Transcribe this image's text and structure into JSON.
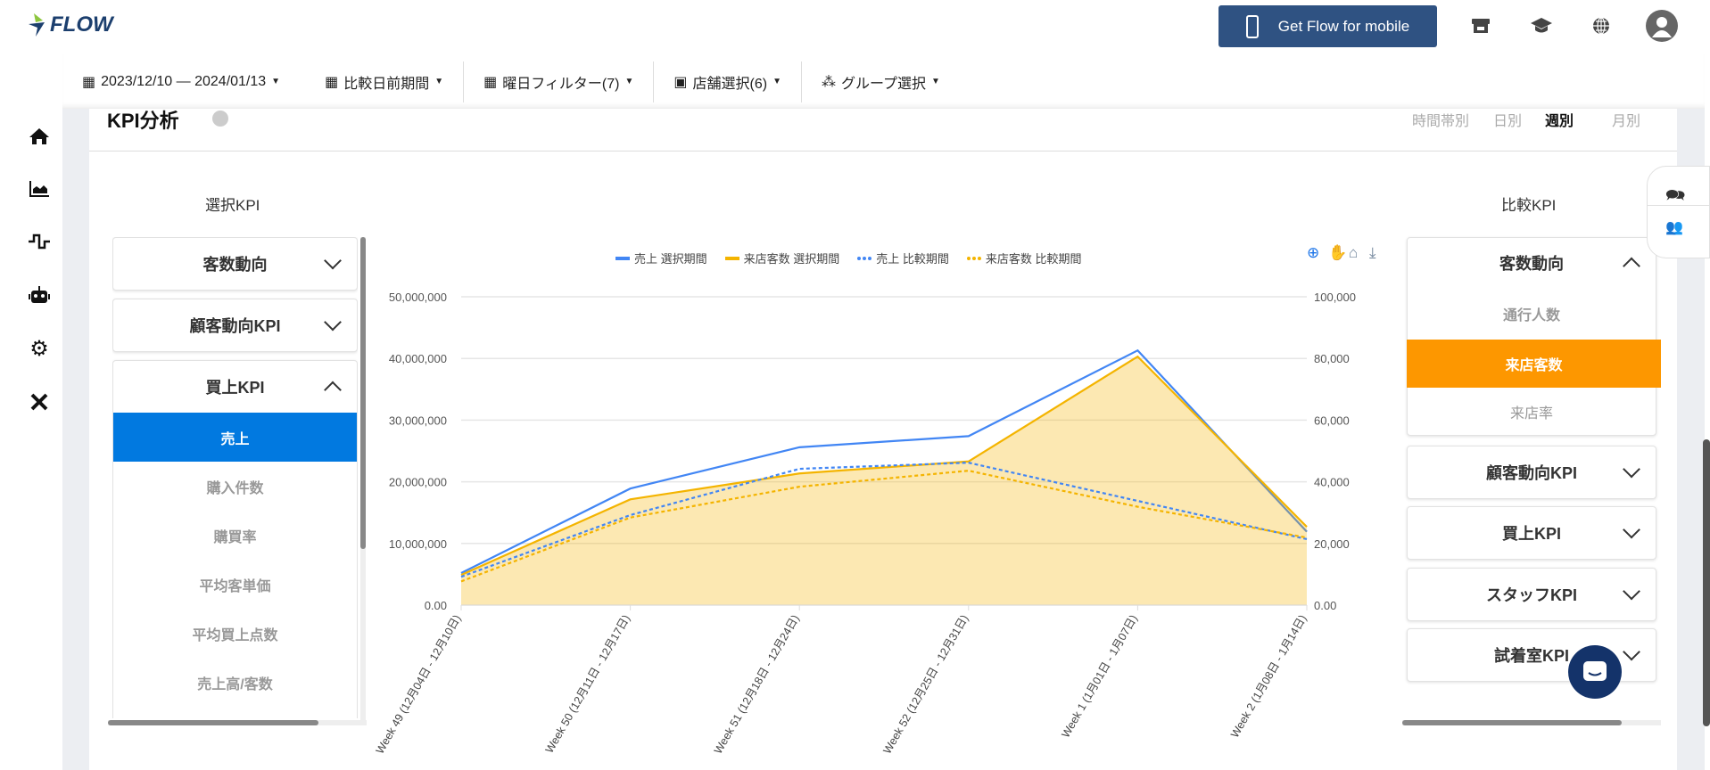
{
  "header": {
    "logo_text": "FLOW",
    "mobile_button": "Get Flow for mobile",
    "icons": [
      "store-icon",
      "graduation-cap-icon",
      "globe-icon",
      "user-avatar-icon"
    ]
  },
  "nav": {
    "icons": [
      "home-icon",
      "area-chart-icon",
      "pulse-icon",
      "robot-icon",
      "gear-icon",
      "tools-icon"
    ]
  },
  "filters": [
    {
      "label": "2023/12/10 — 2024/01/13",
      "icon": "calendar-icon"
    },
    {
      "label": "比較日前期間",
      "icon": "calendar-icon"
    },
    {
      "label": "曜日フィルター(7)",
      "icon": "calendar-icon"
    },
    {
      "label": "店舗選択(6)",
      "icon": "store-icon"
    },
    {
      "label": "グループ選択",
      "icon": "sitemap-icon"
    }
  ],
  "page": {
    "title": "KPI分析",
    "tabs": [
      "時間帯別",
      "日別",
      "週別",
      "月別"
    ],
    "active_tab": "週別"
  },
  "left_panel": {
    "title": "選択KPI",
    "groups": [
      {
        "label": "客数動向",
        "expanded": false
      },
      {
        "label": "顧客動向KPI",
        "expanded": false
      },
      {
        "label": "買上KPI",
        "expanded": true,
        "items": [
          "売上",
          "購入件数",
          "購買率",
          "平均客単価",
          "平均買上点数",
          "売上高/客数"
        ],
        "selected": "売上"
      }
    ]
  },
  "right_panel": {
    "title": "比較KPI",
    "groups": [
      {
        "label": "客数動向",
        "expanded": true,
        "items": [
          "通行人数",
          "来店客数",
          "来店率"
        ],
        "selected": "来店客数"
      },
      {
        "label": "顧客動向KPI",
        "expanded": false
      },
      {
        "label": "買上KPI",
        "expanded": false
      },
      {
        "label": "スタッフKPI",
        "expanded": false
      },
      {
        "label": "試着室KPI",
        "expanded": false
      }
    ]
  },
  "chart_data": {
    "type": "line",
    "categories": [
      "Week 49 (12月04日 - 12月10日)",
      "Week 50 (12月11日 - 12月17日)",
      "Week 51 (12月18日 - 12月24日)",
      "Week 52 (12月25日 - 12月31日)",
      "Week 1 (1月01日 - 1月07日)",
      "Week 2 (1月08日 - 1月14日)"
    ],
    "y_left": {
      "ylim": [
        0,
        50000000
      ],
      "ticks": [
        "0.00",
        "10,000,000",
        "20,000,000",
        "30,000,000",
        "40,000,000",
        "50,000,000"
      ]
    },
    "y_right": {
      "ylim": [
        0,
        100000
      ],
      "ticks": [
        "0.00",
        "20,000",
        "40,000",
        "60,000",
        "80,000",
        "100,000"
      ]
    },
    "grid": true,
    "legend": "top",
    "series": [
      {
        "name": "売上 選択期間",
        "axis": "left",
        "color": "#4286f4",
        "dash": false,
        "fill": false,
        "values": [
          5200000,
          18900000,
          25600000,
          27400000,
          41300000,
          11900000
        ]
      },
      {
        "name": "来店客数 選択期間",
        "axis": "right",
        "color": "#f4b400",
        "dash": false,
        "fill": true,
        "values": [
          9800,
          34300,
          42700,
          46600,
          80600,
          25400
        ]
      },
      {
        "name": "売上 比較期間",
        "axis": "left",
        "color": "#4286f4",
        "dash": true,
        "fill": false,
        "values": [
          4600000,
          14600000,
          22100000,
          23100000,
          16900000,
          10700000
        ]
      },
      {
        "name": "来店客数 比較期間",
        "axis": "right",
        "color": "#f4b400",
        "dash": true,
        "fill": false,
        "values": [
          7700,
          28400,
          38400,
          43600,
          31900,
          21900
        ]
      }
    ]
  },
  "chart_toolbar": [
    "zoom-in-icon",
    "pan-hand-icon",
    "reset-home-icon",
    "download-icon"
  ],
  "side_panel": [
    "chat-icon",
    "users-icon"
  ]
}
